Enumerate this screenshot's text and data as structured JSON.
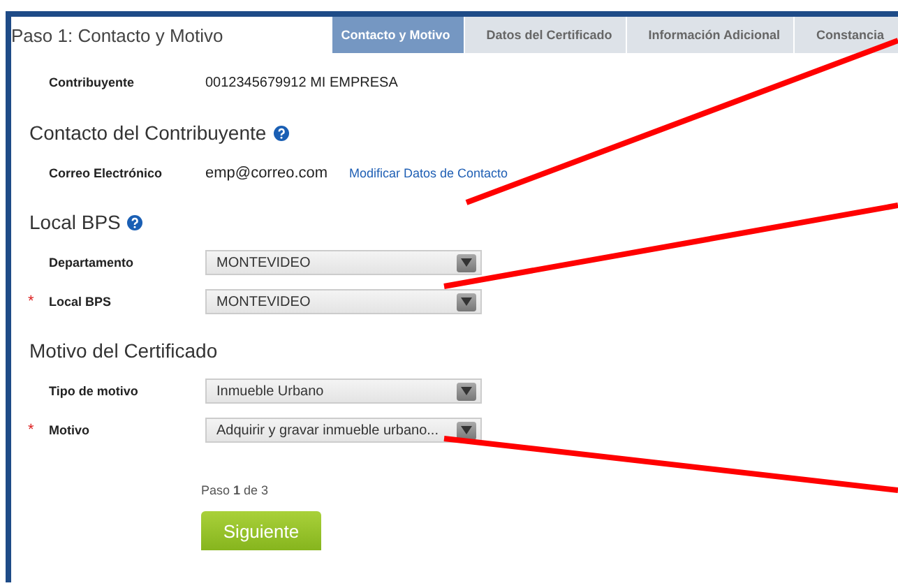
{
  "page": {
    "title": "Paso 1: Contacto y Motivo"
  },
  "steps": [
    {
      "label": "Contacto y Motivo",
      "selected": true
    },
    {
      "label": "Datos del Certificado",
      "selected": false
    },
    {
      "label": "Información Adicional",
      "selected": false
    },
    {
      "label": "Constancia",
      "selected": false
    }
  ],
  "taxpayer": {
    "label": "Contribuyente",
    "value": "0012345679912 MI EMPRESA"
  },
  "sections": [
    {
      "title": "Contacto del Contribuyente",
      "help": true,
      "rows": [
        {
          "kind": "text",
          "label": "Correo Electrónico",
          "value": "emp@correo.com",
          "link": "Modificar Datos de Contacto"
        }
      ]
    },
    {
      "title": "Local BPS",
      "help": true,
      "rows": [
        {
          "kind": "select",
          "label": "Departamento",
          "value": "MONTEVIDEO"
        },
        {
          "kind": "select",
          "label": "Local BPS",
          "required_mark": "*",
          "value": "MONTEVIDEO"
        }
      ]
    },
    {
      "title": "Motivo del Certificado",
      "help": false,
      "rows": [
        {
          "kind": "select",
          "label": "Tipo de motivo",
          "value": "Inmueble Urbano"
        },
        {
          "kind": "select",
          "label": "Motivo",
          "required_mark": "*",
          "value": "Adquirir y gravar inmueble urbano..."
        }
      ]
    }
  ],
  "progress": "Paso **1** de 3",
  "next_button": "Siguiente"
}
